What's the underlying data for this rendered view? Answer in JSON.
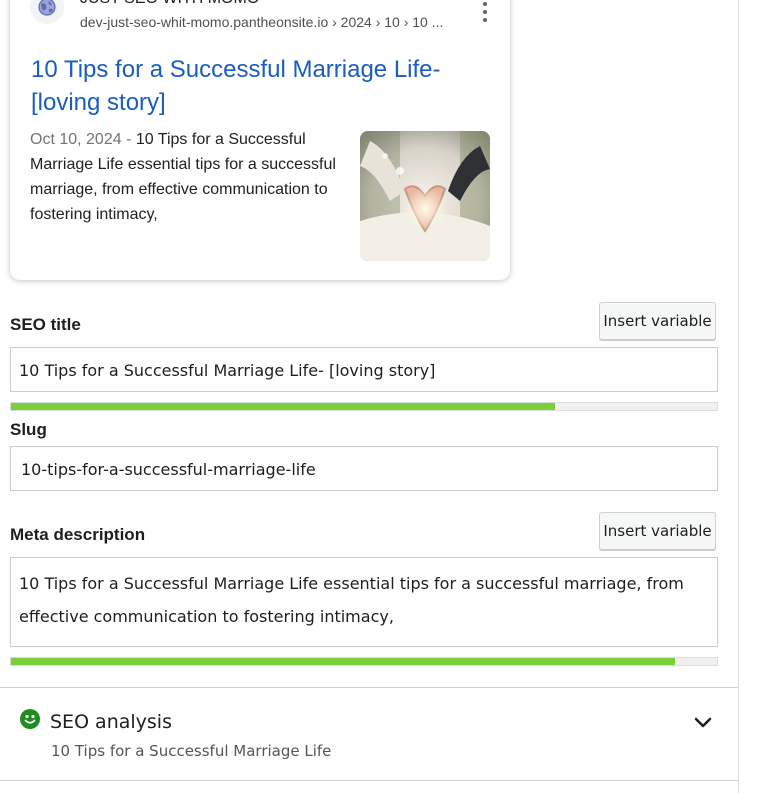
{
  "serp": {
    "site_name": "JUST SEO WITH MOMO",
    "breadcrumb": "dev-just-seo-whit-momo.pantheonsite.io › 2024 › 10 › 10 ...",
    "title": "10 Tips for a Successful Marriage Life- [loving story]",
    "date": "Oct 10, 2024",
    "date_sep": " - ",
    "description": "10 Tips for a Successful Marriage Life essential tips for a successful marriage, from effective communication to fostering intimacy,",
    "link_color": "#1a5cc1"
  },
  "seo_title": {
    "label": "SEO title",
    "insert_label": "Insert variable",
    "value": "10 Tips for a Successful Marriage Life- [loving story]",
    "progress_percent": 77,
    "progress_color": "#7ad03a"
  },
  "slug": {
    "label": "Slug",
    "value": "10-tips-for-a-successful-marriage-life"
  },
  "meta_description": {
    "label": "Meta description",
    "insert_label": "Insert variable",
    "value": "10 Tips for a Successful Marriage Life essential tips for a successful marriage, from effective communication to fostering intimacy,",
    "progress_percent": 94,
    "progress_color": "#7ad03a"
  },
  "seo_analysis": {
    "title": "SEO analysis",
    "keyphrase": "10 Tips for a Successful Marriage Life",
    "status_color": "#1e8c1e",
    "status_icon": "smiley-good-icon",
    "toggle_icon": "chevron-down-icon"
  }
}
